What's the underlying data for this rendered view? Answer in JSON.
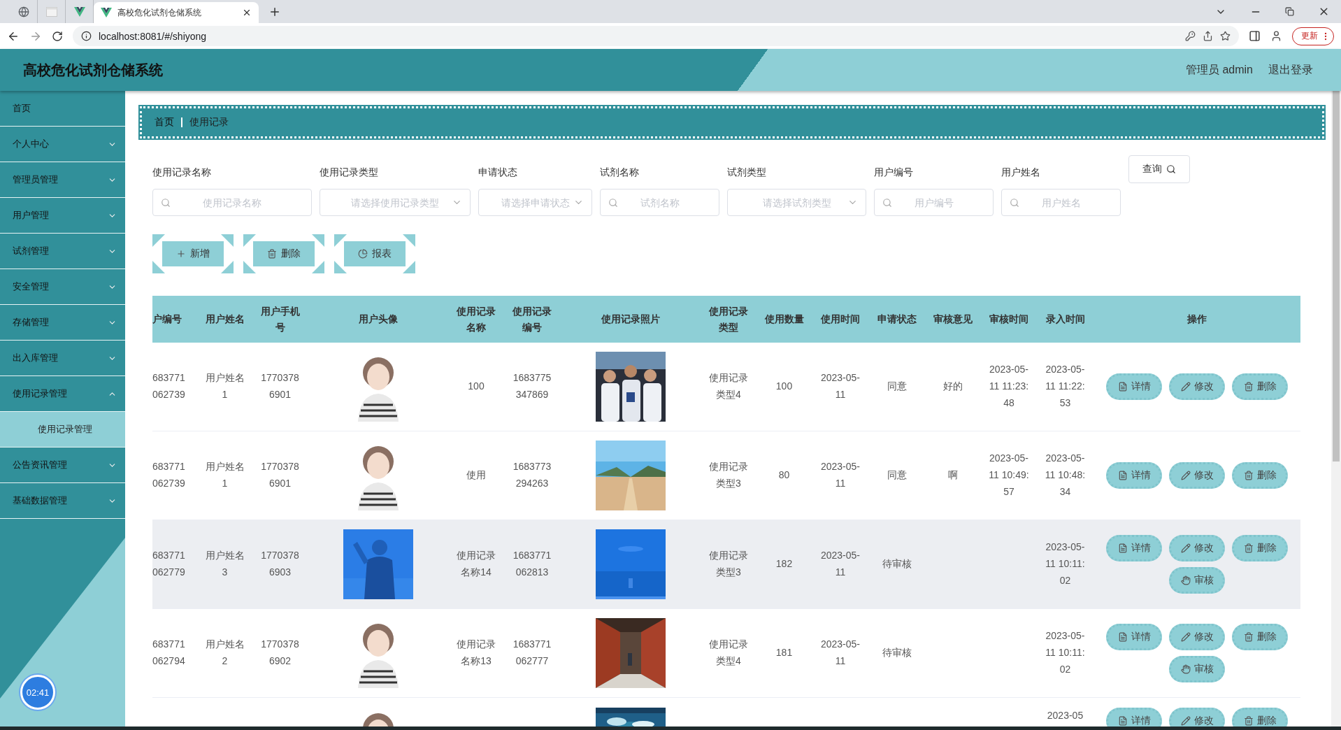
{
  "browser": {
    "tabs": [
      {
        "kind": "globe",
        "selected": false
      },
      {
        "kind": "page",
        "selected": false
      },
      {
        "kind": "vue",
        "selected": false
      },
      {
        "kind": "vue",
        "title": "高校危化试剂仓储系统",
        "selected": true
      }
    ],
    "address": "localhost:8081/#/shiyong",
    "update_button": "更新"
  },
  "header": {
    "title": "高校危化试剂仓储系统",
    "user": "管理员 admin",
    "logout": "退出登录"
  },
  "sidebar": {
    "items": [
      {
        "label": "首页",
        "expandable": false
      },
      {
        "label": "个人中心",
        "expandable": true,
        "expanded": false
      },
      {
        "label": "管理员管理",
        "expandable": true,
        "expanded": false
      },
      {
        "label": "用户管理",
        "expandable": true,
        "expanded": false
      },
      {
        "label": "试剂管理",
        "expandable": true,
        "expanded": false
      },
      {
        "label": "安全管理",
        "expandable": true,
        "expanded": false
      },
      {
        "label": "存储管理",
        "expandable": true,
        "expanded": false
      },
      {
        "label": "出入库管理",
        "expandable": true,
        "expanded": false
      },
      {
        "label": "使用记录管理",
        "expandable": true,
        "expanded": true,
        "children": [
          {
            "label": "使用记录管理",
            "selected": true
          }
        ]
      },
      {
        "label": "公告资讯管理",
        "expandable": true,
        "expanded": false
      },
      {
        "label": "基础数据管理",
        "expandable": true,
        "expanded": false
      }
    ],
    "timer": "02:41"
  },
  "breadcrumb": [
    "首页",
    "使用记录"
  ],
  "filters": [
    {
      "label": "使用记录名称",
      "kind": "input",
      "placeholder": "使用记录名称"
    },
    {
      "label": "使用记录类型",
      "kind": "select",
      "placeholder": "请选择使用记录类型"
    },
    {
      "label": "申请状态",
      "kind": "select",
      "placeholder": "请选择申请状态"
    },
    {
      "label": "试剂名称",
      "kind": "input",
      "placeholder": "试剂名称"
    },
    {
      "label": "试剂类型",
      "kind": "select",
      "placeholder": "请选择试剂类型"
    },
    {
      "label": "用户编号",
      "kind": "input",
      "placeholder": "用户编号"
    },
    {
      "label": "用户姓名",
      "kind": "input",
      "placeholder": "用户姓名"
    }
  ],
  "search_button": "查询",
  "actions": [
    {
      "label": "新增",
      "kind": "add"
    },
    {
      "label": "删除",
      "kind": "delete"
    },
    {
      "label": "报表",
      "kind": "report"
    }
  ],
  "table": {
    "columns": [
      "户编号",
      "用户姓名",
      "用户手机号",
      "用户头像",
      "使用记录名称",
      "使用记录编号",
      "使用记录照片",
      "使用记录类型",
      "使用数量",
      "使用时间",
      "申请状态",
      "审核意见",
      "审核时间",
      "录入时间",
      "操作"
    ],
    "rows": [
      {
        "hovered": false,
        "user_no": "683771062739",
        "user_name": "用户姓名1",
        "phone": "17703786901",
        "avatar": {
          "kind": "figure"
        },
        "record_name": "100",
        "record_no": "1683775347869",
        "photo": {
          "kind": "picture"
        },
        "type": "使用记录类型4",
        "qty": "100",
        "use_time": "2023-05-11",
        "status": "同意",
        "opinion": "好的",
        "review_time": "2023-05-11 11:23:48",
        "entry_time": "2023-05-11 11:22:53",
        "operations": [
          {
            "label": "详情",
            "kind": "detail"
          },
          {
            "label": "修改",
            "kind": "edit"
          },
          {
            "label": "删除",
            "kind": "delete"
          }
        ]
      },
      {
        "hovered": false,
        "user_no": "683771062739",
        "user_name": "用户姓名1",
        "phone": "17703786901",
        "avatar": {
          "kind": "figure"
        },
        "record_name": "使用",
        "record_no": "1683773294263",
        "photo": {
          "kind": "picture"
        },
        "type": "使用记录类型3",
        "qty": "80",
        "use_time": "2023-05-11",
        "status": "同意",
        "opinion": "啊",
        "review_time": "2023-05-11 10:49:57",
        "entry_time": "2023-05-11 10:48:34",
        "operations": [
          {
            "label": "详情",
            "kind": "detail"
          },
          {
            "label": "修改",
            "kind": "edit"
          },
          {
            "label": "删除",
            "kind": "delete"
          }
        ]
      },
      {
        "hovered": true,
        "user_no": "683771062779",
        "user_name": "用户姓名3",
        "phone": "17703786903",
        "avatar": {
          "kind": "picture"
        },
        "record_name": "使用记录名称14",
        "record_no": "1683771062813",
        "photo": {
          "kind": "picture"
        },
        "type": "使用记录类型3",
        "qty": "182",
        "use_time": "2023-05-11",
        "status": "待审核",
        "entry_time": "2023-05-11 10:11:02",
        "operations": [
          {
            "label": "详情",
            "kind": "detail"
          },
          {
            "label": "修改",
            "kind": "edit"
          },
          {
            "label": "删除",
            "kind": "delete"
          },
          {
            "label": "审核",
            "kind": "review"
          }
        ]
      },
      {
        "hovered": false,
        "user_no": "683771062794",
        "user_name": "用户姓名2",
        "phone": "17703786902",
        "avatar": {
          "kind": "figure"
        },
        "record_name": "使用记录名称13",
        "record_no": "1683771062777",
        "photo": {
          "kind": "picture"
        },
        "type": "使用记录类型4",
        "qty": "181",
        "use_time": "2023-05-11",
        "status": "待审核",
        "entry_time": "2023-05-11 10:11:02",
        "operations": [
          {
            "label": "详情",
            "kind": "detail"
          },
          {
            "label": "修改",
            "kind": "edit"
          },
          {
            "label": "删除",
            "kind": "delete"
          },
          {
            "label": "审核",
            "kind": "review"
          }
        ]
      },
      {
        "hovered": false,
        "avatar": {
          "kind": "figure"
        },
        "photo": {
          "kind": "picture"
        },
        "entry_time": "2023-05",
        "operations": [
          {
            "label": "详情",
            "kind": "detail"
          },
          {
            "label": "修改",
            "kind": "edit"
          },
          {
            "label": "删除",
            "kind": "delete"
          }
        ]
      }
    ]
  }
}
